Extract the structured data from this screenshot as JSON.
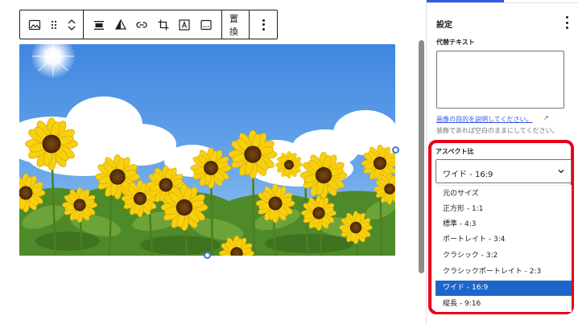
{
  "toolbar": {
    "replace_label": "置換",
    "icons": [
      "image-icon",
      "drag-handle-icon",
      "move-up-icon",
      "move-down-icon",
      "align-icon",
      "duotone-icon",
      "link-icon",
      "crop-icon",
      "text-overlay-icon",
      "caption-icon",
      "more-options-icon"
    ]
  },
  "sidebar": {
    "panel_title": "設定",
    "alt_label": "代替テキスト",
    "alt_value": "",
    "alt_link": "画像の目的を説明してください。",
    "help_text": "装飾であれば空白のままにしてください。",
    "aspect_label": "アスペクト比",
    "aspect_selected": "ワイド - 16:9",
    "aspect_options": [
      "元のサイズ",
      "正方形 - 1:1",
      "標準 - 4:3",
      "ポートレイト - 3:4",
      "クラシック - 3:2",
      "クラシックポートレイト - 2:3",
      "ワイド - 16:9",
      "縦長 - 9:16"
    ],
    "selected_index": 6
  },
  "colors": {
    "highlight": "#e8001b",
    "selected_option": "#1d66c9",
    "link": "#3858e9",
    "handle": "#3a78ce"
  }
}
